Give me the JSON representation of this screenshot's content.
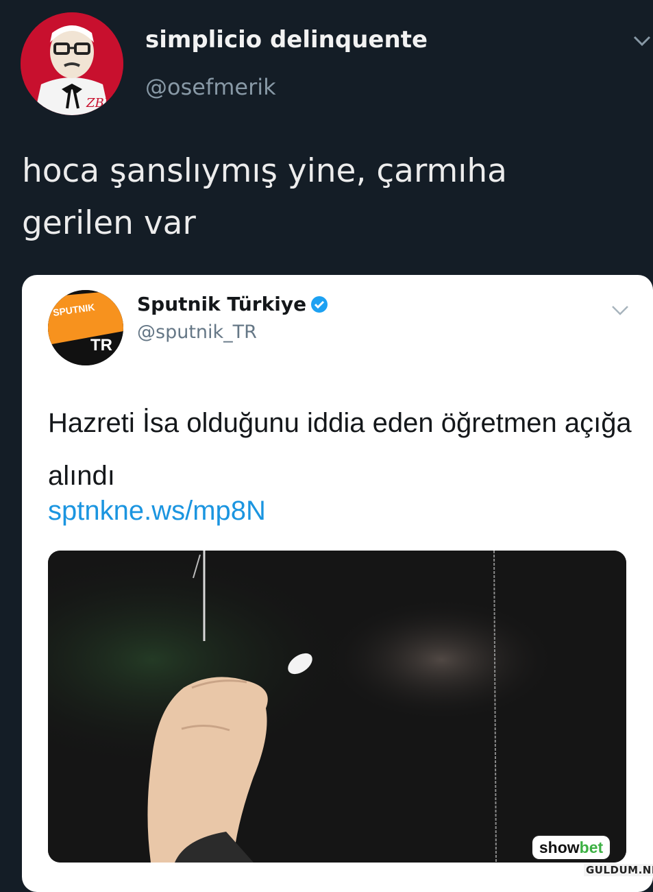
{
  "tweet": {
    "display_name": "simplicio delinquente",
    "handle": "@osefmerik",
    "text": "hoca şanslıymış yine, çarmıha gerilen var",
    "avatar_text": "ZBH",
    "menu_icon": "chevron-down-icon"
  },
  "quoted": {
    "display_name": "Sputnik Türkiye",
    "verified": true,
    "handle": "@sputnik_TR",
    "text": "Hazreti İsa olduğunu iddia eden öğretmen açığa alındı",
    "link": "sptnkne.ws/mp8N",
    "avatar_top": "SPUTNIK",
    "avatar_bottom": "TR",
    "menu_icon": "chevron-down-icon"
  },
  "watermarks": {
    "badge_show": "show",
    "badge_bet": "bet",
    "site": "GULDUM.NET"
  },
  "colors": {
    "background": "#141d26",
    "link": "#1b95e0",
    "verified": "#1da1f2",
    "sputnik_orange": "#f7921e"
  }
}
